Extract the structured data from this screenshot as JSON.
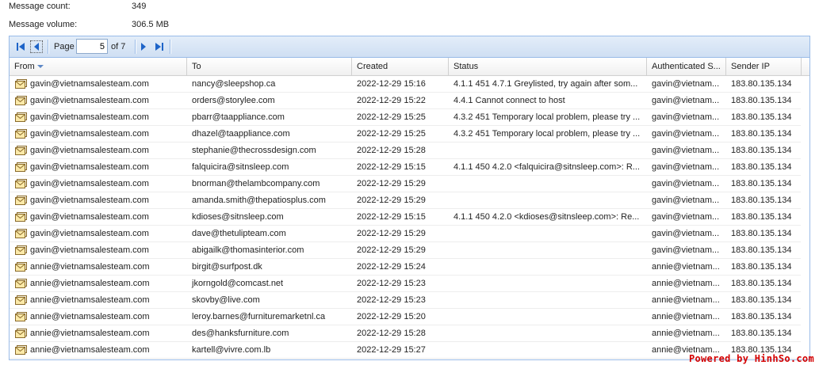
{
  "summary": {
    "count_label": "Message count:",
    "count_value": "349",
    "volume_label": "Message volume:",
    "volume_value": "306.5 MB"
  },
  "pager": {
    "page_label": "Page",
    "current_page": "5",
    "of_label": "of 7"
  },
  "columns": {
    "from": "From",
    "to": "To",
    "created": "Created",
    "status": "Status",
    "auth": "Authenticated S...",
    "ip": "Sender IP"
  },
  "rows": [
    {
      "from": "gavin@vietnamsalesteam.com",
      "to": "nancy@sleepshop.ca",
      "created": "2022-12-29 15:16",
      "status": "4.1.1 451 4.7.1 Greylisted, try again after som...",
      "auth": "gavin@vietnam...",
      "ip": "183.80.135.134"
    },
    {
      "from": "gavin@vietnamsalesteam.com",
      "to": "orders@storylee.com",
      "created": "2022-12-29 15:22",
      "status": "4.4.1 Cannot connect to host",
      "auth": "gavin@vietnam...",
      "ip": "183.80.135.134"
    },
    {
      "from": "gavin@vietnamsalesteam.com",
      "to": "pbarr@taappliance.com",
      "created": "2022-12-29 15:25",
      "status": "4.3.2 451 Temporary local problem, please try ...",
      "auth": "gavin@vietnam...",
      "ip": "183.80.135.134"
    },
    {
      "from": "gavin@vietnamsalesteam.com",
      "to": "dhazel@taappliance.com",
      "created": "2022-12-29 15:25",
      "status": "4.3.2 451 Temporary local problem, please try ...",
      "auth": "gavin@vietnam...",
      "ip": "183.80.135.134"
    },
    {
      "from": "gavin@vietnamsalesteam.com",
      "to": "stephanie@thecrossdesign.com",
      "created": "2022-12-29 15:28",
      "status": "",
      "auth": "gavin@vietnam...",
      "ip": "183.80.135.134"
    },
    {
      "from": "gavin@vietnamsalesteam.com",
      "to": "falquicira@sitnsleep.com",
      "created": "2022-12-29 15:15",
      "status": "4.1.1 450 4.2.0 <falquicira@sitnsleep.com>: R...",
      "auth": "gavin@vietnam...",
      "ip": "183.80.135.134"
    },
    {
      "from": "gavin@vietnamsalesteam.com",
      "to": "bnorman@thelambcompany.com",
      "created": "2022-12-29 15:29",
      "status": "",
      "auth": "gavin@vietnam...",
      "ip": "183.80.135.134"
    },
    {
      "from": "gavin@vietnamsalesteam.com",
      "to": "amanda.smith@thepatiosplus.com",
      "created": "2022-12-29 15:29",
      "status": "",
      "auth": "gavin@vietnam...",
      "ip": "183.80.135.134"
    },
    {
      "from": "gavin@vietnamsalesteam.com",
      "to": "kdioses@sitnsleep.com",
      "created": "2022-12-29 15:15",
      "status": "4.1.1 450 4.2.0 <kdioses@sitnsleep.com>: Re...",
      "auth": "gavin@vietnam...",
      "ip": "183.80.135.134"
    },
    {
      "from": "gavin@vietnamsalesteam.com",
      "to": "dave@thetulipteam.com",
      "created": "2022-12-29 15:29",
      "status": "",
      "auth": "gavin@vietnam...",
      "ip": "183.80.135.134"
    },
    {
      "from": "gavin@vietnamsalesteam.com",
      "to": "abigailk@thomasinterior.com",
      "created": "2022-12-29 15:29",
      "status": "",
      "auth": "gavin@vietnam...",
      "ip": "183.80.135.134"
    },
    {
      "from": "annie@vietnamsalesteam.com",
      "to": "birgit@surfpost.dk",
      "created": "2022-12-29 15:24",
      "status": "",
      "auth": "annie@vietnam...",
      "ip": "183.80.135.134"
    },
    {
      "from": "annie@vietnamsalesteam.com",
      "to": "jkorngold@comcast.net",
      "created": "2022-12-29 15:23",
      "status": "",
      "auth": "annie@vietnam...",
      "ip": "183.80.135.134"
    },
    {
      "from": "annie@vietnamsalesteam.com",
      "to": "skovby@live.com",
      "created": "2022-12-29 15:23",
      "status": "",
      "auth": "annie@vietnam...",
      "ip": "183.80.135.134"
    },
    {
      "from": "annie@vietnamsalesteam.com",
      "to": "leroy.barnes@furnituremarketnl.ca",
      "created": "2022-12-29 15:20",
      "status": "",
      "auth": "annie@vietnam...",
      "ip": "183.80.135.134"
    },
    {
      "from": "annie@vietnamsalesteam.com",
      "to": "des@hanksfurniture.com",
      "created": "2022-12-29 15:28",
      "status": "",
      "auth": "annie@vietnam...",
      "ip": "183.80.135.134"
    },
    {
      "from": "annie@vietnamsalesteam.com",
      "to": "kartell@vivre.com.lb",
      "created": "2022-12-29 15:27",
      "status": "",
      "auth": "annie@vietnam...",
      "ip": "183.80.135.134"
    }
  ],
  "icons": {
    "first_page": "first-page-icon",
    "prev_page": "prev-page-icon",
    "next_page": "next-page-icon",
    "last_page": "last-page-icon",
    "message": "envelope-icon"
  },
  "colors": {
    "accent_blue": "#1e64c8",
    "grid_border": "#99bbe8",
    "watermark": "#d40000"
  },
  "watermark": "Powered by HinhSo.com"
}
